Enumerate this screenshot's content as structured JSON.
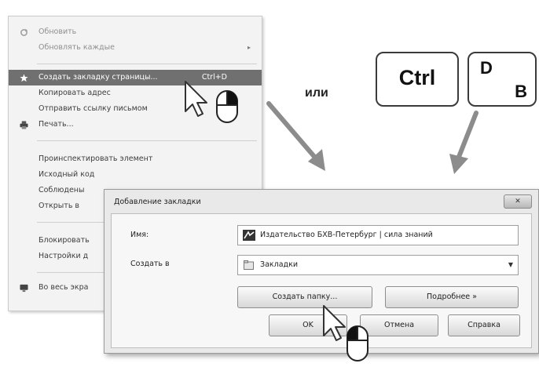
{
  "context_menu": {
    "items": [
      {
        "label": "Обновить",
        "disabled": true
      },
      {
        "label": "Обновлять каждые",
        "disabled": true,
        "submenu": "▸"
      },
      {
        "label": "Создать закладку страницы...",
        "shortcut": "Ctrl+D",
        "highlighted": true
      },
      {
        "label": "Копировать адрес"
      },
      {
        "label": "Отправить ссылку письмом"
      },
      {
        "label": "Печать..."
      },
      {
        "label": "Проинспектировать элемент"
      },
      {
        "label": "Исходный код"
      },
      {
        "label": "Соблюдены"
      },
      {
        "label": "Открыть в"
      },
      {
        "label": "Блокировать"
      },
      {
        "label": "Настройки д"
      },
      {
        "label": "Во весь экра"
      }
    ]
  },
  "keys": {
    "ctrl": "Ctrl",
    "d_top": "D",
    "d_bottom": "B",
    "or_label": "или"
  },
  "dialog": {
    "title": "Добавление закладки",
    "close": "✕",
    "name_label": "Имя:",
    "name_value": "Издательство БХВ-Петербург | сила знаний",
    "create_in_label": "Создать в",
    "folder_value": "Закладки",
    "new_folder_button": "Создать папку...",
    "details_button": "Подробнее »",
    "ok_button": "OK",
    "cancel_button": "Отмена",
    "help_button": "Справка"
  },
  "colors": {
    "highlight": "#707070",
    "menu_bg": "#f3f3f3",
    "arrow": "#8c8c8c"
  }
}
